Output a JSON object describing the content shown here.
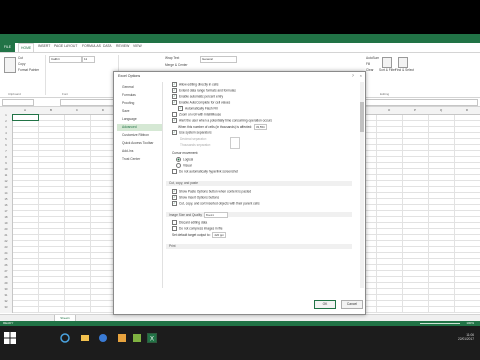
{
  "ribbon_tabs": [
    "FILE",
    "HOME",
    "INSERT",
    "PAGE LAYOUT",
    "FORMULAS",
    "DATA",
    "REVIEW",
    "VIEW"
  ],
  "ribbon": {
    "cut": "Cut",
    "copy": "Copy",
    "format_painter": "Format Painter",
    "font_name": "Calibri",
    "font_size": "11",
    "wrap_text": "Wrap Text",
    "merge_center": "Merge & Center",
    "number_format": "General",
    "autosum": "AutoSum",
    "fill": "Fill",
    "clear": "Clear",
    "sort_filter": "Sort & Filter",
    "find_select": "Find & Select",
    "groups": [
      "Clipboard",
      "Font",
      "Alignment",
      "Number",
      "Styles",
      "Cells",
      "Editing"
    ]
  },
  "columns": [
    "A",
    "B",
    "C",
    "D",
    "E",
    "F",
    "G",
    "H",
    "I",
    "J",
    "K",
    "L",
    "M",
    "N",
    "O",
    "P",
    "Q",
    "R"
  ],
  "rows": [
    "1",
    "2",
    "3",
    "4",
    "5",
    "6",
    "7",
    "8",
    "9",
    "10",
    "11",
    "12",
    "13",
    "14",
    "15",
    "16",
    "17",
    "18",
    "19",
    "20",
    "21",
    "22",
    "23",
    "24",
    "25",
    "26",
    "27",
    "28",
    "29",
    "30",
    "31",
    "32",
    "33"
  ],
  "sheet_tab": "Sheet1",
  "status": "READY",
  "zoom": "100%",
  "dialog": {
    "title": "Excel Options",
    "help": "?",
    "close": "×",
    "nav": [
      "General",
      "Formulas",
      "Proofing",
      "Save",
      "Language",
      "Advanced",
      "Customize Ribbon",
      "Quick Access Toolbar",
      "Add-Ins",
      "Trust Center"
    ],
    "selected_nav": "Advanced",
    "options": [
      {
        "label": "Allow editing directly in cells",
        "checked": true
      },
      {
        "label": "Extend data range formats and formulas",
        "checked": true
      },
      {
        "label": "Enable automatic percent entry",
        "checked": true
      },
      {
        "label": "Enable AutoComplete for cell values",
        "checked": true
      },
      {
        "label": "Automatically Flash Fill",
        "checked": true,
        "indent": true
      },
      {
        "label": "Zoom on roll with IntelliMouse",
        "checked": false
      },
      {
        "label": "Alert the user when a potentially time consuming operation occurs",
        "checked": true
      },
      {
        "label": "When this number of cells (in thousands) is affected:",
        "value": "33,554",
        "indent": true
      }
    ],
    "system_separators": "Use system separators",
    "decimal_sep": "Decimal separator:",
    "thousands_sep": "Thousands separator:",
    "cursor_movement": "Cursor movement:",
    "logical": "Logical",
    "visual": "Visual",
    "no_hyperlink": "Do not automatically hyperlink screenshot",
    "section_cut": "Cut, copy, and paste",
    "paste_options": "Show Paste Options button when content is pasted",
    "insert_options": "Show Insert Options buttons",
    "cut_copy_sort": "Cut, copy, and sort inserted objects with their parent cells",
    "section_image": "Image Size and Quality",
    "image_book": "Book1",
    "discard_edit": "Discard editing data",
    "no_compress": "Do not compress images in file",
    "default_target": "Set default target output to:",
    "ppi": "220 ppi",
    "section_print": "Print",
    "ok": "OK",
    "cancel": "Cancel"
  },
  "taskbar": {
    "time": "11:06",
    "date": "22/01/2017"
  }
}
